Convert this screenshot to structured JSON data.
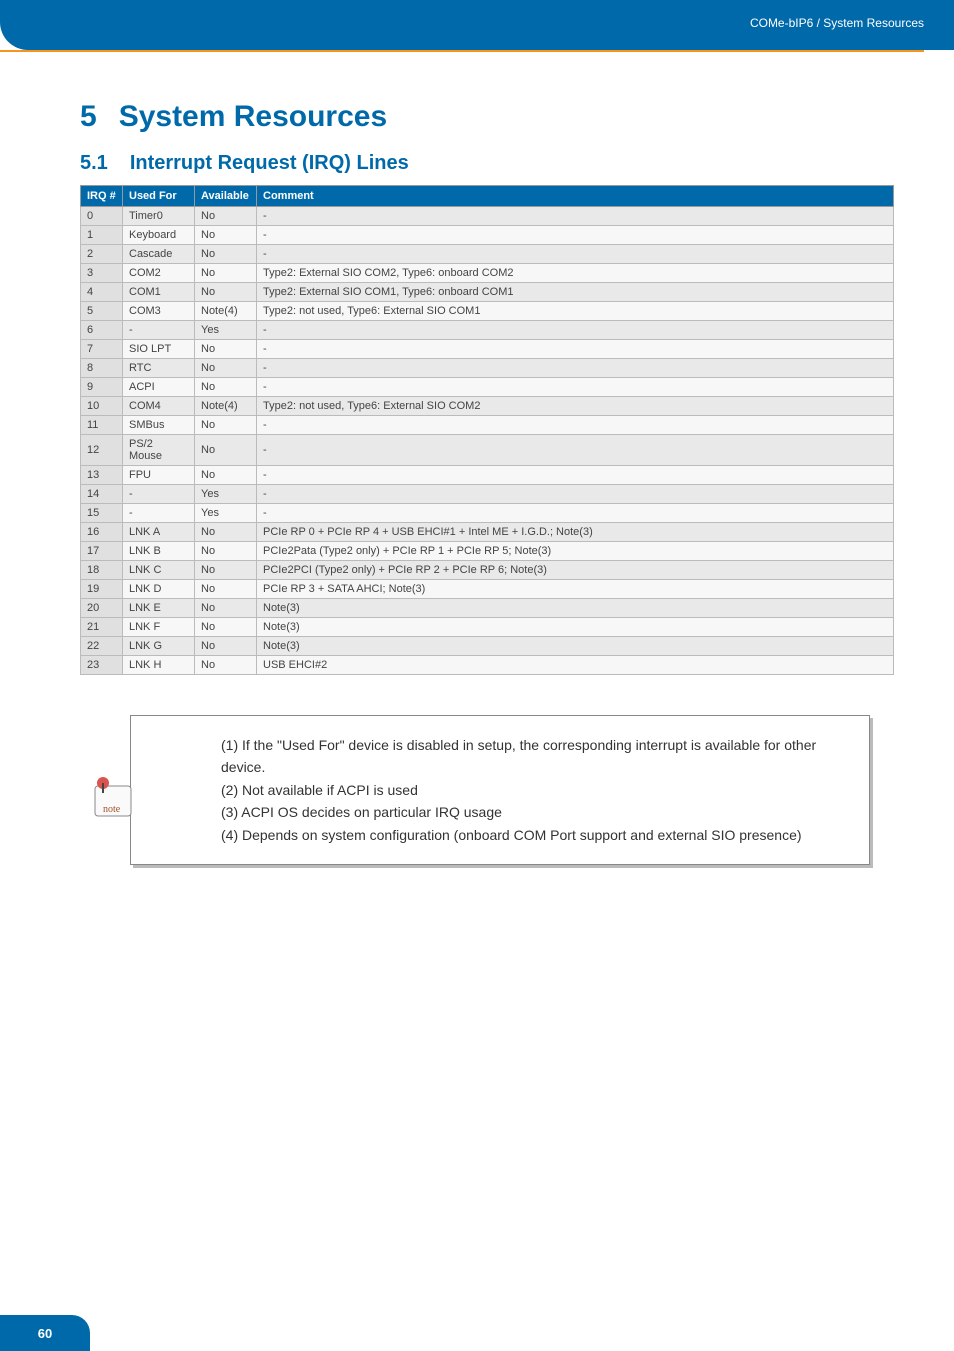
{
  "header": {
    "breadcrumb": "COMe-bIP6 / System Resources"
  },
  "h1": {
    "num": "5",
    "title": "System Resources"
  },
  "h2": {
    "num": "5.1",
    "title": "Interrupt Request (IRQ) Lines"
  },
  "table": {
    "headers": [
      "IRQ #",
      "Used For",
      "Available",
      "Comment"
    ],
    "rows": [
      {
        "irq": "0",
        "used": "Timer0",
        "avail": "No",
        "comment": "-"
      },
      {
        "irq": "1",
        "used": "Keyboard",
        "avail": "No",
        "comment": "-"
      },
      {
        "irq": "2",
        "used": "Cascade",
        "avail": "No",
        "comment": "-"
      },
      {
        "irq": "3",
        "used": "COM2",
        "avail": "No",
        "comment": "Type2: External SIO COM2, Type6: onboard COM2"
      },
      {
        "irq": "4",
        "used": "COM1",
        "avail": "No",
        "comment": "Type2: External SIO COM1, Type6: onboard COM1"
      },
      {
        "irq": "5",
        "used": "COM3",
        "avail": "Note(4)",
        "comment": "Type2: not used, Type6: External SIO COM1"
      },
      {
        "irq": "6",
        "used": "-",
        "avail": "Yes",
        "comment": "-"
      },
      {
        "irq": "7",
        "used": "SIO LPT",
        "avail": "No",
        "comment": "-"
      },
      {
        "irq": "8",
        "used": "RTC",
        "avail": "No",
        "comment": "-"
      },
      {
        "irq": "9",
        "used": "ACPI",
        "avail": "No",
        "comment": "-"
      },
      {
        "irq": "10",
        "used": "COM4",
        "avail": "Note(4)",
        "comment": "Type2: not used, Type6: External SIO COM2"
      },
      {
        "irq": "11",
        "used": "SMBus",
        "avail": "No",
        "comment": "-"
      },
      {
        "irq": "12",
        "used": "PS/2 Mouse",
        "avail": "No",
        "comment": "-"
      },
      {
        "irq": "13",
        "used": "FPU",
        "avail": "No",
        "comment": "-"
      },
      {
        "irq": "14",
        "used": "-",
        "avail": "Yes",
        "comment": "-"
      },
      {
        "irq": "15",
        "used": "-",
        "avail": "Yes",
        "comment": "-"
      },
      {
        "irq": "16",
        "used": "LNK A",
        "avail": "No",
        "comment": "PCIe RP 0 + PCIe RP 4 + USB EHCI#1 + Intel ME + I.G.D.; Note(3)"
      },
      {
        "irq": "17",
        "used": "LNK B",
        "avail": "No",
        "comment": "PCIe2Pata (Type2 only) + PCIe RP 1 + PCIe RP 5; Note(3)"
      },
      {
        "irq": "18",
        "used": "LNK C",
        "avail": "No",
        "comment": "PCIe2PCI (Type2 only) + PCIe RP 2 + PCIe RP 6; Note(3)"
      },
      {
        "irq": "19",
        "used": "LNK D",
        "avail": "No",
        "comment": "PCIe RP 3 + SATA AHCI; Note(3)"
      },
      {
        "irq": "20",
        "used": "LNK E",
        "avail": "No",
        "comment": "Note(3)"
      },
      {
        "irq": "21",
        "used": "LNK F",
        "avail": "No",
        "comment": "Note(3)"
      },
      {
        "irq": "22",
        "used": "LNK G",
        "avail": "No",
        "comment": "Note(3)"
      },
      {
        "irq": "23",
        "used": "LNK H",
        "avail": "No",
        "comment": "USB EHCI#2"
      }
    ]
  },
  "notes": {
    "n1": "(1) If the \"Used For\" device is disabled in setup, the corresponding interrupt is available for other device.",
    "n2": "(2) Not available if ACPI is used",
    "n3": "(3) ACPI OS decides on particular IRQ usage",
    "n4": "(4) Depends on system configuration (onboard COM Port support and external SIO presence)"
  },
  "page_num": "60"
}
